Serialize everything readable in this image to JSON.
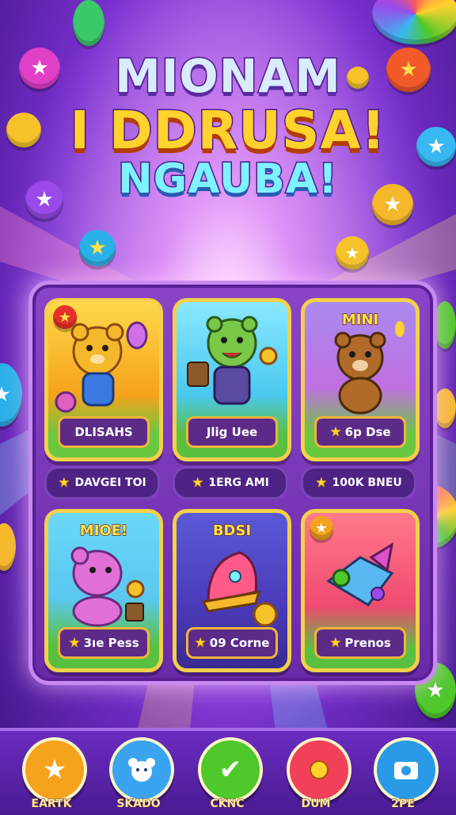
{
  "title": {
    "line1": "MIONAM",
    "line2": "I DDRUSA!",
    "line3": "NGAUBA!"
  },
  "cards": [
    {
      "top_text": "",
      "label": "DLISAHS",
      "badge": "star-badge"
    },
    {
      "top_text": "",
      "label": "Jlig Uee",
      "badge": ""
    },
    {
      "top_text": "MINI",
      "label": "6p Dse",
      "badge": ""
    },
    {
      "top_text": "MIOE!",
      "label": "3ıe Pess",
      "badge": ""
    },
    {
      "top_text": "BDSI",
      "label": "09 Corne",
      "badge": ""
    },
    {
      "top_text": "",
      "label": "Prenos",
      "badge": "star-badge"
    }
  ],
  "pills": [
    {
      "label": "DAVGEI TOI"
    },
    {
      "label": "1ERG AMI"
    },
    {
      "label": "100K BNEU"
    }
  ],
  "nav": [
    {
      "label": "EARTK",
      "icon": "home-star-icon",
      "color": "#f5a21c"
    },
    {
      "label": "SKADO",
      "icon": "bear-face-icon",
      "color": "#3aa4f0"
    },
    {
      "label": "CKNC",
      "icon": "checkmark-icon",
      "color": "#4ec82a"
    },
    {
      "label": "DUM",
      "icon": "sun-icon",
      "color": "#f0405a"
    },
    {
      "label": "2PE",
      "icon": "camera-icon",
      "color": "#2a9ae8"
    }
  ]
}
